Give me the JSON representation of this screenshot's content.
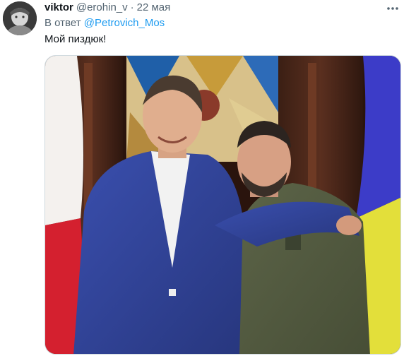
{
  "tweet": {
    "display_name": "viktor",
    "handle": "@erohin_v",
    "separator": "·",
    "date": "22 мая",
    "reply_prefix": "В ответ",
    "reply_to": "@Petrovich_Mos",
    "text": "Мой пиздюк!"
  },
  "icons": {
    "more": "more-horizontal-icon",
    "avatar": "avatar-image"
  },
  "colors": {
    "link": "#1d9bf0",
    "secondary_text": "#536471",
    "primary_text": "#0f1419",
    "media_border": "#cfd9de"
  }
}
